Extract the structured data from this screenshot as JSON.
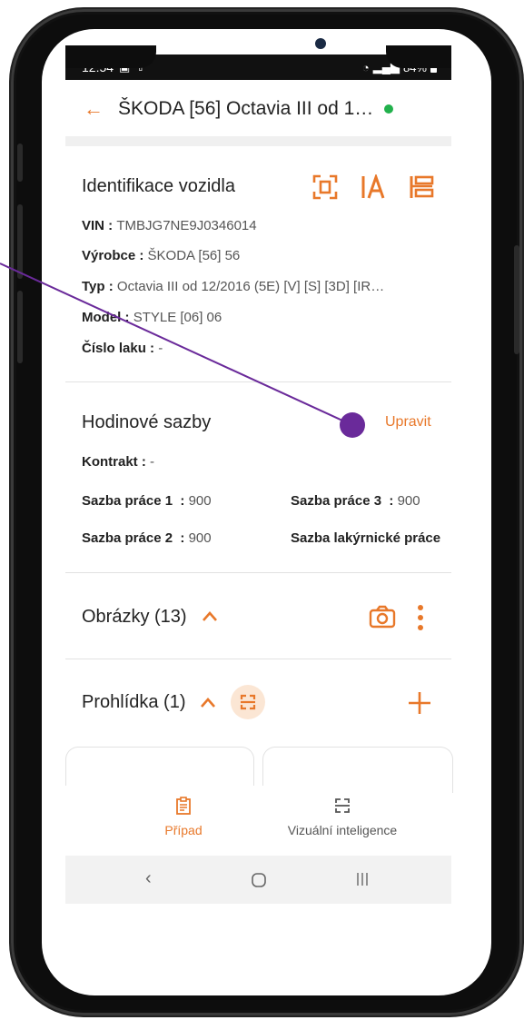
{
  "status_bar": {
    "time": "12:54",
    "battery": "84%"
  },
  "app_bar": {
    "title": "ŠKODA [56] Octavia III od 1…"
  },
  "vehicle": {
    "title": "Identifikace vozidla",
    "rows": [
      {
        "key": "VIN",
        "value": "TMBJG7NE9J0346014"
      },
      {
        "key": "Výrobce",
        "value": "ŠKODA [56] 56"
      },
      {
        "key": "Typ",
        "value": "Octavia III od 12/2016 (5E) [V] [S] [3D] [IR…"
      },
      {
        "key": "Model",
        "value": "STYLE [06] 06"
      },
      {
        "key": "Číslo laku",
        "value": "-"
      }
    ]
  },
  "rates": {
    "title": "Hodinové sazby",
    "edit_label": "Upravit",
    "contract_key": "Kontrakt",
    "contract_value": "-",
    "rate1_key": "Sazba práce 1",
    "rate1_value": "900",
    "rate2_key": "Sazba práce 2",
    "rate2_value": "900",
    "rate3_key": "Sazba práce 3",
    "rate3_value": "900",
    "paint_key": "Sazba lakýrnické práce"
  },
  "images": {
    "title": "Obrázky (13)"
  },
  "inspection": {
    "title": "Prohlídka (1)"
  },
  "bottom_nav": {
    "case_label": "Případ",
    "vision_label": "Vizuální inteligence"
  },
  "colors": {
    "accent": "#e8782a",
    "online": "#22b14c",
    "annotation": "#6a2a9a"
  }
}
